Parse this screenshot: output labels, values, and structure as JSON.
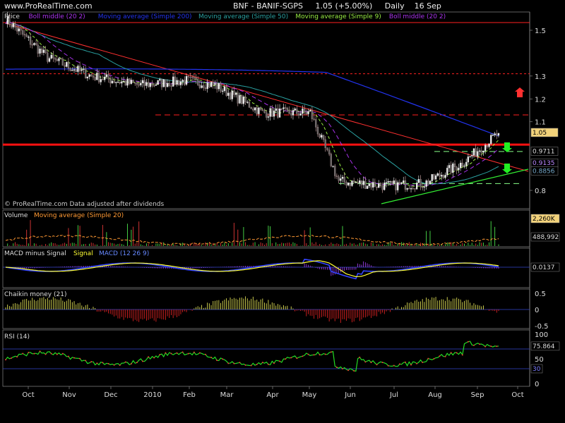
{
  "header": {
    "site": "www.ProRealTime.com",
    "symbol": "BNF - BANIF-SGPS",
    "quote": "1.05 (+5.00%)",
    "period": "Daily",
    "date": "16 Sep"
  },
  "watermark": "© ProRealTime.com Data adjusted after dividends",
  "x_labels": [
    "Oct",
    "Nov",
    "Dec",
    "2010",
    "Feb",
    "Mar",
    "Apr",
    "May",
    "Jun",
    "Jul",
    "Aug",
    "Sep",
    "Oct"
  ],
  "colors": {
    "price_up": "#00dd00",
    "price_down": "#cc3333",
    "ma200": "#2233ee",
    "ma50": "#2aa0a0",
    "ma9": "#99ee44",
    "boll": "#aa33ee",
    "resist": "#ff2020",
    "volume": "#ff9933",
    "macd": "#3344ff",
    "signal": "#ffff33",
    "chaikin_pos": "#dddd55",
    "chaikin_neg": "#dd2222",
    "rsi": "#22dd22"
  },
  "chart_data": [
    {
      "type": "line",
      "panel": "price",
      "legend": [
        "Price",
        "Boll middle (20 2)",
        "Moving average (Simple 200)",
        "Moving average (Simple 50)",
        "Moving average (Simple 9)",
        "Boll middle (20 2)"
      ],
      "ylim": [
        0.72,
        1.58
      ],
      "y_ticks": [
        1.5,
        1.3,
        1.2,
        1.1,
        0.8
      ],
      "y_tick_labels": [
        "1.5",
        "1.3",
        "1.2",
        "1.1",
        "0.8"
      ],
      "value_labels": [
        "1.05",
        "0.9711",
        "0.9135",
        "0.8856"
      ],
      "value_levels": [
        1.05,
        0.9711,
        0.9135,
        0.8856
      ],
      "x": [
        "Sep",
        "Oct",
        "Nov",
        "Dec",
        "2010",
        "Feb",
        "Mar",
        "Apr",
        "May",
        "Jun",
        "Jul",
        "Aug",
        "Sep"
      ],
      "close_approx": [
        1.54,
        1.35,
        1.3,
        1.25,
        1.28,
        1.26,
        1.13,
        1.14,
        0.85,
        0.82,
        0.83,
        0.92,
        1.05
      ],
      "levels": {
        "resistance_1": 1.54,
        "resistance_2": 1.31,
        "resistance_3": 1.13,
        "thick_red": 1.0,
        "dash_green_1": 0.97,
        "dash_green_2": 0.83
      }
    },
    {
      "type": "bar",
      "panel": "volume",
      "legend": [
        "Volume",
        "Moving average (Simple 20)"
      ],
      "value_labels": [
        "2,260K",
        "488,992"
      ]
    },
    {
      "type": "line",
      "panel": "macd",
      "legend": [
        "MACD minus Signal",
        "Signal",
        "MACD (12 26 9)"
      ],
      "value_labels": [
        "0.0137"
      ]
    },
    {
      "type": "bar",
      "panel": "chaikin",
      "legend": [
        "Chaikin money (21)"
      ],
      "ylim": [
        -0.5,
        0.5
      ],
      "y_tick_labels": [
        "0.5",
        "0",
        "-0.5"
      ]
    },
    {
      "type": "line",
      "panel": "rsi",
      "legend": [
        "RSI (14)"
      ],
      "ylim": [
        0,
        100
      ],
      "y_tick_labels": [
        "100",
        "50",
        "0"
      ],
      "value_labels": [
        "75.864",
        "30"
      ]
    }
  ]
}
